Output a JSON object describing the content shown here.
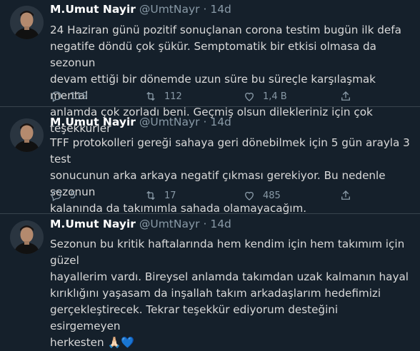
{
  "tweets": [
    {
      "name": "M.Umut Nayir",
      "handle": "@UmtNayr",
      "sep": "·",
      "time": "14d",
      "text": "24 Haziran günü pozitif sonuçlanan corona testim bugün ilk defa\nnegatife döndü çok şükür. Semptomatik bir etkisi olmasa da sezonun\ndevam ettiği bir dönemde uzun süre bu süreçle karşılaşmak mental\nanlamda çok zorladı beni. Geçmiş olsun dilekleriniz için çok teşekkürler",
      "replies": "119",
      "retweets": "112",
      "likes": "1,4 B"
    },
    {
      "name": "M.Umut Nayir",
      "handle": "@UmtNayr",
      "sep": "·",
      "time": "14d",
      "text": "TFF protokolleri gereği sahaya geri dönebilmek için 5 gün arayla 3 test\nsonucunun arka arkaya negatif çıkması gerekiyor. Bu nedenle sezonun\nkalanında da takımımla sahada olamayacağım.",
      "replies": "5",
      "retweets": "17",
      "likes": "485"
    },
    {
      "name": "M.Umut Nayir",
      "handle": "@UmtNayr",
      "sep": "·",
      "time": "14d",
      "text": "Sezonun bu kritik haftalarında hem kendim için hem takımım için güzel\nhayallerim vardı. Bireysel anlamda takımdan uzak kalmanın hayal\nkırıklığını yaşasam da inşallah takım arkadaşlarım hedefimizi\ngerçekleştirecek. Tekrar teşekkür ediyorum desteğini esirgemeyen\nherkesten",
      "emoji": "🙏🏻💙"
    }
  ],
  "colors": {
    "background": "#15202b",
    "name": "#ffffff",
    "secondary": "#8899a6",
    "text": "#d9d9d9",
    "border": "#38444d"
  },
  "icons": [
    "reply-icon",
    "retweet-icon",
    "like-icon",
    "share-icon"
  ]
}
